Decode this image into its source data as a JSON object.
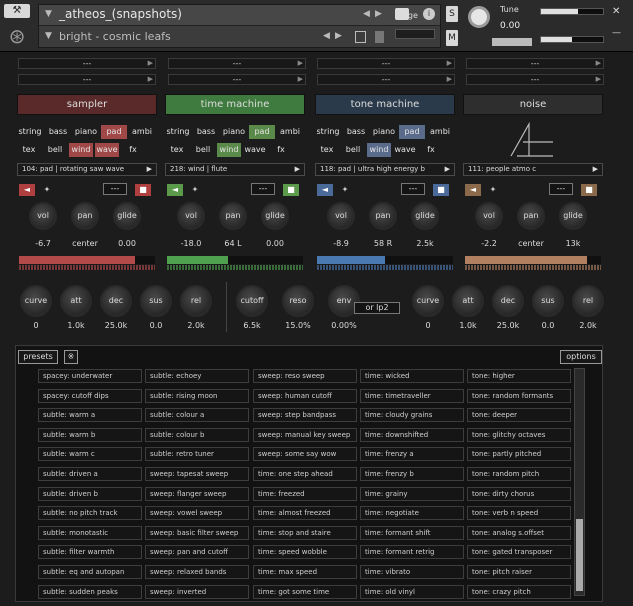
{
  "header": {
    "instrument_name": "_atheos_(snapshots)",
    "snapshot_name": "bright - cosmic leafs",
    "purge_label": "Purge",
    "s_label": "S",
    "m_label": "M",
    "tune_label": "Tune",
    "tune_value": "0.00",
    "volume_level": 0.6,
    "pan_level": 0.5
  },
  "dash_strips": [
    "---",
    "---",
    "---",
    "---",
    "---",
    "---",
    "---",
    "---"
  ],
  "modules": [
    {
      "tab": "sampler",
      "tab_color": "#5a2a2a",
      "tags": [
        "string",
        "bass",
        "piano",
        "pad",
        "ambi",
        "tex",
        "bell",
        "wind",
        "wave",
        "fx"
      ],
      "active": [
        "pad",
        "wind",
        "wave"
      ],
      "active_color": "#a04848",
      "preset": "104: pad | rotating saw wave",
      "accent": "#b04040",
      "box": "---",
      "knobs": [
        {
          "label": "vol",
          "value": "-6.7"
        },
        {
          "label": "pan",
          "value": "center"
        },
        {
          "label": "glide",
          "value": "0.00"
        }
      ],
      "meter_color": "#b24a4a",
      "meter_level": 0.85
    },
    {
      "tab": "time machine",
      "tab_color": "#3f7a3f",
      "tags": [
        "string",
        "bass",
        "piano",
        "pad",
        "ambi",
        "tex",
        "bell",
        "wind",
        "wave",
        "fx"
      ],
      "active": [
        "pad",
        "wind"
      ],
      "active_color": "#5a8a4a",
      "preset": "218: wind | flute",
      "accent": "#5a9a4a",
      "box": "---",
      "knobs": [
        {
          "label": "vol",
          "value": "-18.0"
        },
        {
          "label": "pan",
          "value": "64 L"
        },
        {
          "label": "glide",
          "value": "0.00"
        }
      ],
      "meter_color": "#4fa04f",
      "meter_level": 0.45
    },
    {
      "tab": "tone machine",
      "tab_color": "#2a3a4a",
      "tags": [
        "string",
        "bass",
        "piano",
        "pad",
        "ambi",
        "tex",
        "bell",
        "wind",
        "wave",
        "fx"
      ],
      "active": [
        "pad",
        "wind"
      ],
      "active_color": "#5a6a8a",
      "preset": "118: pad | ultra high energy b",
      "accent": "#4a6a9a",
      "box": "---",
      "knobs": [
        {
          "label": "vol",
          "value": "-8.9"
        },
        {
          "label": "pan",
          "value": "58 R"
        },
        {
          "label": "glide",
          "value": "2.5k"
        }
      ],
      "meter_color": "#4a78b0",
      "meter_level": 0.5
    },
    {
      "tab": "noise",
      "tab_color": "#2e2e2e",
      "tags": [],
      "active": [],
      "active_color": "#555",
      "preset": "111: people atmo c",
      "accent": "#8a6a4a",
      "box": "---",
      "knobs": [
        {
          "label": "vol",
          "value": "-2.2"
        },
        {
          "label": "pan",
          "value": "center"
        },
        {
          "label": "glide",
          "value": "13k"
        }
      ],
      "meter_color": "#b08060",
      "meter_level": 0.9
    }
  ],
  "envelope_knobs": [
    {
      "label": "curve",
      "value": "0"
    },
    {
      "label": "att",
      "value": "1.0k"
    },
    {
      "label": "dec",
      "value": "25.0k"
    },
    {
      "label": "sus",
      "value": "0.0"
    },
    {
      "label": "rel",
      "value": "2.0k"
    }
  ],
  "filter_knobs": [
    {
      "label": "cutoff",
      "value": "6.5k"
    },
    {
      "label": "reso",
      "value": "15.0%"
    },
    {
      "label": "env",
      "value": "0.00%"
    }
  ],
  "filter_type": "or lp2",
  "envelope2_knobs": [
    {
      "label": "curve",
      "value": "0"
    },
    {
      "label": "att",
      "value": "1.0k"
    },
    {
      "label": "dec",
      "value": "25.0k"
    },
    {
      "label": "sus",
      "value": "0.0"
    },
    {
      "label": "rel",
      "value": "2.0k"
    }
  ],
  "browser": {
    "presets_label": "presets",
    "options_label": "options",
    "columns": [
      [
        "spacey: underwater",
        "spacey: cutoff dips",
        "subtle: warm a",
        "subtle: warm b",
        "subtle: warm c",
        "subtle: driven a",
        "subtle: driven b",
        "subtle: no pitch track",
        "subtle: monotastic",
        "subtle: filter warmth",
        "subtle: eq and autopan",
        "subtle: sudden peaks"
      ],
      [
        "subtle: echoey",
        "subtle: rising moon",
        "subtle: colour a",
        "subtle: colour b",
        "subtle: retro tuner",
        "sweep: tapesat sweep",
        "sweep: flanger sweep",
        "sweep: vowel sweep",
        "sweep: basic filter sweep",
        "sweep: pan and cutoff",
        "sweep: relaxed bands",
        "sweep: inverted"
      ],
      [
        "sweep: reso sweep",
        "sweep: human cutoff",
        "sweep: step bandpass",
        "sweep: manual key sweep",
        "sweep: some say wow",
        "time: one step ahead",
        "time: freezed",
        "time: almost freezed",
        "time: stop and staire",
        "time: speed wobble",
        "time: max speed",
        "time: got some time"
      ],
      [
        "time: wicked",
        "time: timetraveller",
        "time: cloudy grains",
        "time: downshifted",
        "time: frenzy a",
        "time: frenzy b",
        "time: grainy",
        "time: negotiate",
        "time: formant shift",
        "time: formant retrig",
        "time: vibrato",
        "time: old vinyl"
      ],
      [
        "tone: higher",
        "tone: random formants",
        "tone: deeper",
        "tone: glitchy octaves",
        "tone: partly pitched",
        "tone: random pitch",
        "tone: dirty chorus",
        "tone: verb n speed",
        "tone: analog s.offset",
        "tone: gated transposer",
        "tone: pitch raiser",
        "tone: crazy pitch"
      ]
    ]
  }
}
